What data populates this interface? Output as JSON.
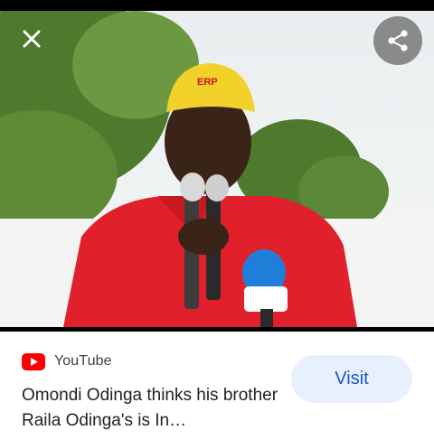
{
  "viewer": {
    "close_icon": "close-icon",
    "share_icon": "share-icon",
    "image_alt": ""
  },
  "result": {
    "source_icon": "youtube-logo-icon",
    "source_name": "YouTube",
    "title": "Omondi Odinga thinks his brother Raila Odinga's is In…",
    "visit_label": "Visit"
  },
  "colors": {
    "visit_bg": "#e8f0fe",
    "visit_text": "#1a56c9",
    "youtube_red": "#ff0000"
  }
}
